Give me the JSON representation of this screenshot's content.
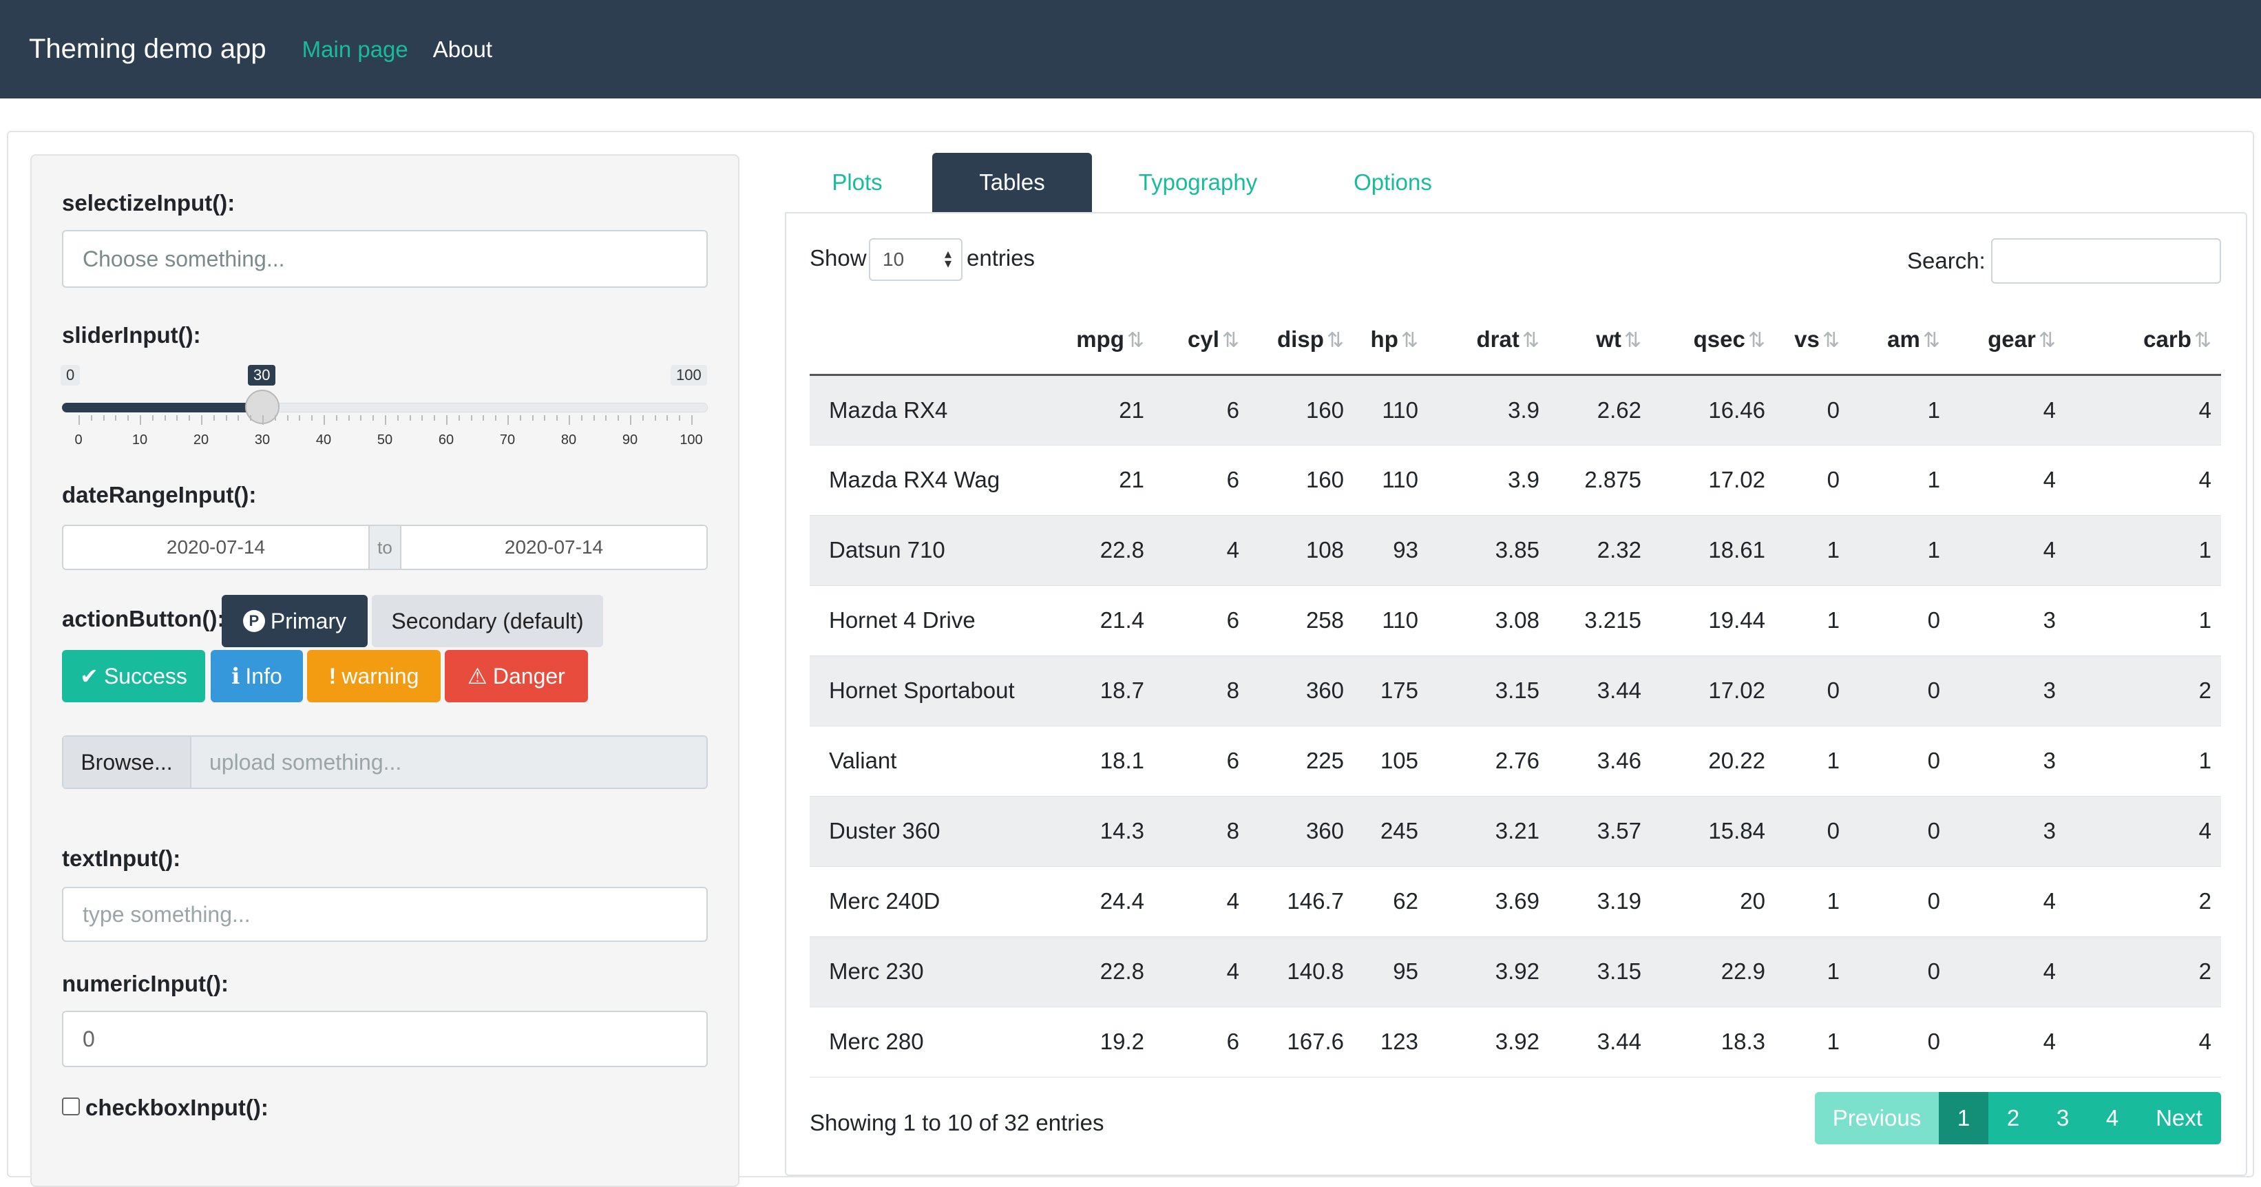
{
  "navbar": {
    "brand": "Theming demo app",
    "links": [
      "Main page",
      "About"
    ]
  },
  "sidebar": {
    "selectize_label": "selectizeInput():",
    "selectize_placeholder": "Choose something...",
    "slider_label": "sliderInput():",
    "slider_min": "0",
    "slider_max": "100",
    "slider_value": "30",
    "slider_ticks": [
      "0",
      "10",
      "20",
      "30",
      "40",
      "50",
      "60",
      "70",
      "80",
      "90",
      "100"
    ],
    "daterange_label": "dateRangeInput():",
    "date_start": "2020-07-14",
    "date_sep": "to",
    "date_end": "2020-07-14",
    "action_label": "actionButton():",
    "buttons": {
      "primary": "Primary",
      "secondary": "Secondary (default)",
      "success": "Success",
      "info": "Info",
      "warning": "warning",
      "danger": "Danger"
    },
    "browse_button": "Browse...",
    "browse_placeholder": "upload something...",
    "text_label": "textInput():",
    "text_placeholder": "type something...",
    "numeric_label": "numericInput():",
    "numeric_value": "0",
    "checkbox_label": "checkboxInput():"
  },
  "tabs": [
    "Plots",
    "Tables",
    "Typography",
    "Options"
  ],
  "table_controls": {
    "show": "Show",
    "page_length": "10",
    "entries": "entries",
    "search": "Search:"
  },
  "table": {
    "columns": [
      "",
      "mpg",
      "cyl",
      "disp",
      "hp",
      "drat",
      "wt",
      "qsec",
      "vs",
      "am",
      "gear",
      "carb"
    ],
    "rows": [
      [
        "Mazda RX4",
        "21",
        "6",
        "160",
        "110",
        "3.9",
        "2.62",
        "16.46",
        "0",
        "1",
        "4",
        "4"
      ],
      [
        "Mazda RX4 Wag",
        "21",
        "6",
        "160",
        "110",
        "3.9",
        "2.875",
        "17.02",
        "0",
        "1",
        "4",
        "4"
      ],
      [
        "Datsun 710",
        "22.8",
        "4",
        "108",
        "93",
        "3.85",
        "2.32",
        "18.61",
        "1",
        "1",
        "4",
        "1"
      ],
      [
        "Hornet 4 Drive",
        "21.4",
        "6",
        "258",
        "110",
        "3.08",
        "3.215",
        "19.44",
        "1",
        "0",
        "3",
        "1"
      ],
      [
        "Hornet Sportabout",
        "18.7",
        "8",
        "360",
        "175",
        "3.15",
        "3.44",
        "17.02",
        "0",
        "0",
        "3",
        "2"
      ],
      [
        "Valiant",
        "18.1",
        "6",
        "225",
        "105",
        "2.76",
        "3.46",
        "20.22",
        "1",
        "0",
        "3",
        "1"
      ],
      [
        "Duster 360",
        "14.3",
        "8",
        "360",
        "245",
        "3.21",
        "3.57",
        "15.84",
        "0",
        "0",
        "3",
        "4"
      ],
      [
        "Merc 240D",
        "24.4",
        "4",
        "146.7",
        "62",
        "3.69",
        "3.19",
        "20",
        "1",
        "0",
        "4",
        "2"
      ],
      [
        "Merc 230",
        "22.8",
        "4",
        "140.8",
        "95",
        "3.92",
        "3.15",
        "22.9",
        "1",
        "0",
        "4",
        "2"
      ],
      [
        "Merc 280",
        "19.2",
        "6",
        "167.6",
        "123",
        "3.92",
        "3.44",
        "18.3",
        "1",
        "0",
        "4",
        "4"
      ]
    ]
  },
  "footer": {
    "info": "Showing 1 to 10 of 32 entries",
    "pagination": [
      "Previous",
      "1",
      "2",
      "3",
      "4",
      "Next"
    ]
  }
}
